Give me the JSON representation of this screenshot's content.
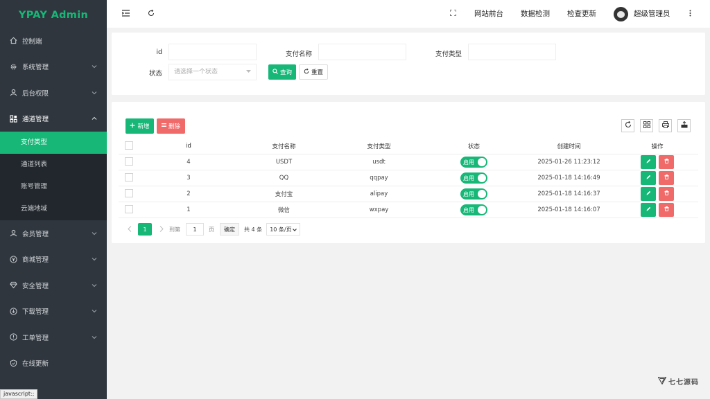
{
  "app": {
    "brand": "YPAY Admin"
  },
  "sidebar": {
    "items": [
      {
        "label": "控制端",
        "icon": "home-icon"
      },
      {
        "label": "系统管理",
        "icon": "gear-icon"
      },
      {
        "label": "后台权限",
        "icon": "user-icon"
      },
      {
        "label": "通道管理",
        "icon": "grid-icon"
      },
      {
        "label": "会员管理",
        "icon": "user-icon"
      },
      {
        "label": "商城管理",
        "icon": "yen-icon"
      },
      {
        "label": "安全管理",
        "icon": "diamond-icon"
      },
      {
        "label": "下载管理",
        "icon": "download-icon"
      },
      {
        "label": "工单管理",
        "icon": "info-icon"
      },
      {
        "label": "在线更新",
        "icon": "shield-icon"
      }
    ],
    "subitems": [
      {
        "label": "支付类型"
      },
      {
        "label": "通道列表"
      },
      {
        "label": "账号管理"
      },
      {
        "label": "云端地域"
      }
    ]
  },
  "header": {
    "links": [
      "网站前台",
      "数据检测",
      "检查更新"
    ],
    "user": "超级管理员"
  },
  "search": {
    "id_label": "id",
    "name_label": "支付名称",
    "type_label": "支付类型",
    "status_label": "状态",
    "status_placeholder": "请选择一个状态",
    "query": "查询",
    "reset": "重置"
  },
  "toolbar": {
    "add": "新增",
    "delete": "删除"
  },
  "table": {
    "headers": [
      "id",
      "支付名称",
      "支付类型",
      "状态",
      "创建时间",
      "操作"
    ],
    "rows": [
      {
        "id": "4",
        "name": "USDT",
        "type": "usdt",
        "status": "启用",
        "created": "2025-01-26 11:23:12"
      },
      {
        "id": "3",
        "name": "QQ",
        "type": "qqpay",
        "status": "启用",
        "created": "2025-01-18 14:16:49"
      },
      {
        "id": "2",
        "name": "支付宝",
        "type": "alipay",
        "status": "启用",
        "created": "2025-01-18 14:16:37"
      },
      {
        "id": "1",
        "name": "微信",
        "type": "wxpay",
        "status": "启用",
        "created": "2025-01-18 14:16:07"
      }
    ]
  },
  "pager": {
    "current": "1",
    "goto": "到第",
    "page_value": "1",
    "page_unit": "页",
    "confirm": "确定",
    "total": "共 4 条",
    "size": "10 条/页"
  },
  "status_bar": "javascript:;",
  "watermark": "七七源码"
}
